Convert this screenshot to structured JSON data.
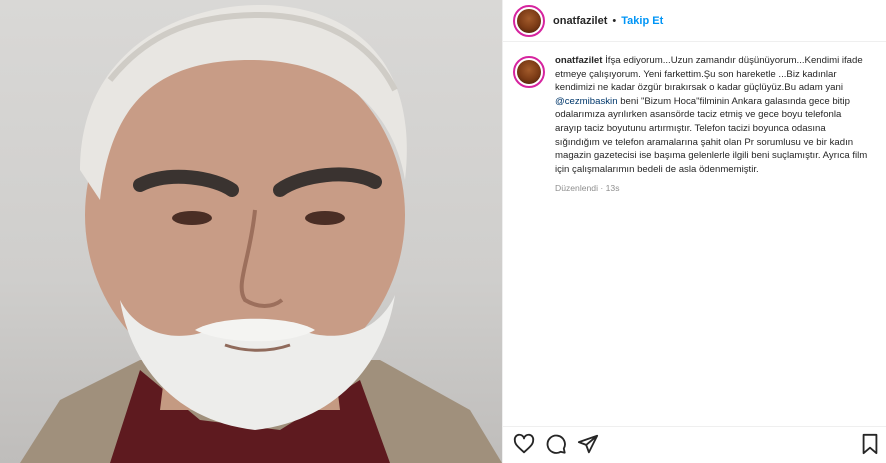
{
  "post": {
    "username": "onatfazilet",
    "separator": "•",
    "follow_label": "Takip Et"
  },
  "caption": {
    "username": "onatfazilet",
    "text_before": " İfşa ediyorum...Uzun zamandır düşünüyorum...Kendimi ifade etmeye çalışıyorum. Yeni farkettim.Şu son hareketle ...Biz kadınlar kendimizi ne kadar özgür bırakırsak o kadar güçlüyüz.Bu adam yani ",
    "mention": "@cezmibaskin",
    "text_after": " beni \"Bizum Hoca\"filminin Ankara galasında gece bitip odalarımıza ayrılırken asansörde taciz etmiş ve gece boyu telefonla arayıp taciz boyutunu artırmıştır. Telefon tacizi boyunca odasına sığındığım ve telefon aramalarına şahit olan Pr sorumlusu ve bir kadın magazin gazetecisi ise başıma gelenlerle ilgili beni suçlamıştır. Ayrıca film için çalışmalarımın bedeli de asla ödenmemiştir.",
    "edited": "Düzenlendi · 13s"
  },
  "icons": [
    "heart-icon",
    "comment-icon",
    "share-icon",
    "bookmark-icon"
  ]
}
